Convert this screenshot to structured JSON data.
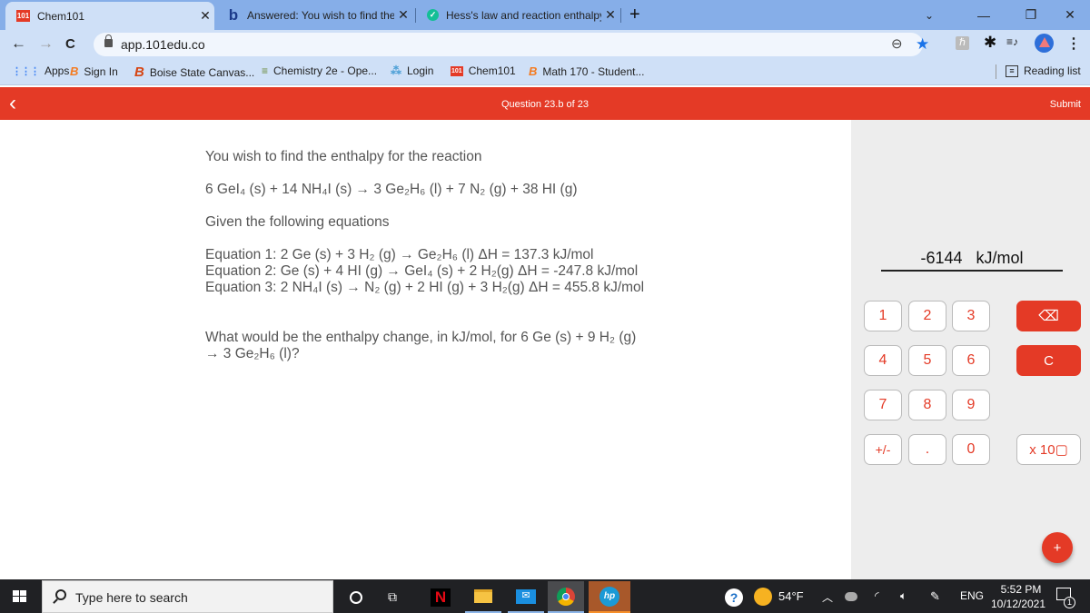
{
  "browser": {
    "tabs": [
      {
        "title": "Chem101",
        "favicon": "101-logo-icon",
        "active": true
      },
      {
        "title": "Answered: You wish to find the e",
        "favicon": "bartleby-b-icon",
        "active": false
      },
      {
        "title": "Hess's law and reaction enthalpy",
        "favicon": "khan-academy-icon",
        "active": false
      }
    ],
    "new_tab_symbol": "+",
    "window_controls": {
      "tab_search": "⌄",
      "minimize": "—",
      "restore": "❐",
      "close": "✕"
    },
    "nav": {
      "back": "←",
      "forward": "→",
      "reload": "C"
    },
    "url": "app.101edu.co",
    "toolbar_icons": {
      "zoom": "⊖",
      "bookmark_star": "★",
      "extension_h": "ℏ",
      "extensions": "✱",
      "media": "≡♪",
      "menu": "⋮"
    },
    "bookmarks": [
      {
        "label": "Apps",
        "icon": "apps-grid-icon"
      },
      {
        "label": "Sign In",
        "icon": "boise-state-b-icon"
      },
      {
        "label": "Boise State Canvas...",
        "icon": "boise-state-b-icon"
      },
      {
        "label": "Chemistry 2e - Ope...",
        "icon": "book-stack-icon"
      },
      {
        "label": "Login",
        "icon": "login-sparkle-icon"
      },
      {
        "label": "Chem101",
        "icon": "101-logo-icon"
      },
      {
        "label": "Math 170 - Student...",
        "icon": "boise-state-b-icon"
      }
    ],
    "reading_list": "Reading list"
  },
  "header": {
    "back_symbol": "‹",
    "question_label": "Question 23.b of 23",
    "submit_label": "Submit",
    "accent_color": "#e43a26"
  },
  "question": {
    "intro": "You wish to find the enthalpy for the reaction",
    "target_reaction": "6 GeI₄ (s) + 14 NH₄I (s) → 3 Ge₂H₆ (l) + 7 N₂ (g) + 38 HI (g)",
    "given_label": "Given the following equations",
    "equations": [
      "Equation 1: 2 Ge (s) + 3 H₂ (g) → Ge₂H₆ (l) ΔH = 137.3 kJ/mol",
      "Equation 2: Ge (s) + 4 HI (g) → GeI₄ (s) + 2 H₂(g)  ΔH = -247.8 kJ/mol",
      "Equation 3: 2 NH₄I (s) → N₂ (g) + 2 HI (g) + 3 H₂(g) ΔH = 455.8 kJ/mol"
    ],
    "prompt_line1": "What would be the enthalpy change, in kJ/mol, for 6 Ge (s) + 9 H₂ (g)",
    "prompt_line2": "→ 3 Ge₂H₆ (l)?"
  },
  "calculator": {
    "display_value": "-6144",
    "display_unit": "kJ/mol",
    "keys": [
      "1",
      "2",
      "3",
      "4",
      "5",
      "6",
      "7",
      "8",
      "9",
      "+/-",
      ".",
      "0"
    ],
    "backspace": "⌫",
    "clear": "C",
    "exponent": "x 10▢",
    "fab": "+"
  },
  "taskbar": {
    "search_placeholder": "Type here to search",
    "apps": [
      "cortana-icon",
      "task-view-icon",
      "netflix-icon",
      "file-explorer-icon",
      "mail-icon",
      "chrome-icon",
      "hp-icon"
    ],
    "help_badge": "?",
    "weather": "54°F",
    "language": "ENG",
    "time": "5:52 PM",
    "date": "10/12/2021",
    "notification_count": "1"
  }
}
